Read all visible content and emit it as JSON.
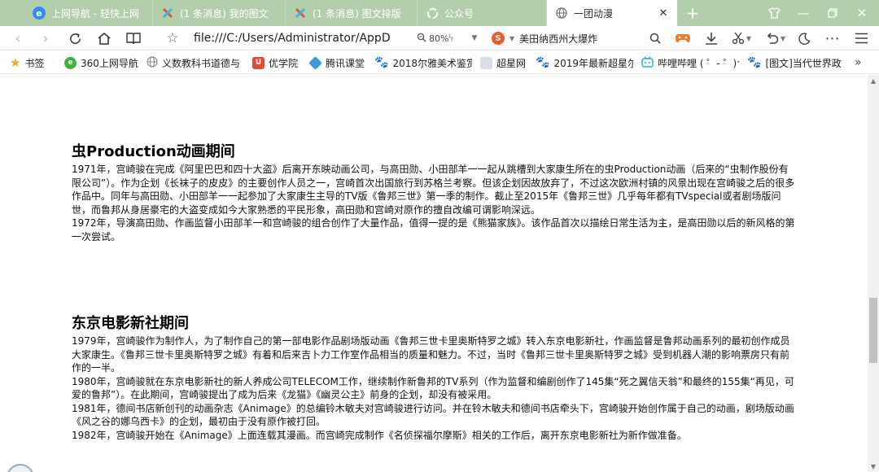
{
  "tabs": [
    {
      "title": "上网导航 - 轻快上网",
      "favicon": "e-browser-icon",
      "color": "#2d8ff0"
    },
    {
      "title": "(1 条消息) 我的图文",
      "favicon": "colorful-x-icon",
      "color": "#e0533a"
    },
    {
      "title": "(1 条消息) 图文排版",
      "favicon": "colorful-x-icon",
      "color": "#e0533a"
    },
    {
      "title": "公众号",
      "favicon": "wechat-spin-icon",
      "color": "#ffffff"
    },
    {
      "title": "一团动漫",
      "favicon": "globe-icon",
      "color": "#666666",
      "active": true
    }
  ],
  "address": {
    "url": "file:///C:/Users/Administrator/AppD",
    "zoom": "80%",
    "search_text": "美田纳西州大爆炸"
  },
  "bookmarks": [
    {
      "label": "书签",
      "icon": "star-icon",
      "color": "#f5a623"
    },
    {
      "label": "360上网导航",
      "icon": "360-icon",
      "color": "#3cb43c"
    },
    {
      "label": "义数教科书道德与",
      "icon": "globe-icon",
      "color": "#8a8a8a"
    },
    {
      "label": "优学院",
      "icon": "youxueyuan-icon",
      "color": "#e04a3a"
    },
    {
      "label": "腾讯课堂",
      "icon": "tencent-class-icon",
      "color": "#3a9be0"
    },
    {
      "label": "2018尔雅美术鉴赏",
      "icon": "paw-icon",
      "color": "#3060d0"
    },
    {
      "label": "超星网",
      "icon": "chaoxing-icon",
      "color": "#d8dde8"
    },
    {
      "label": "2019年最新超星尔",
      "icon": "paw-icon",
      "color": "#3060d0"
    },
    {
      "label": "哔哩哔哩 ( ゜- ゜)つ",
      "icon": "bilibili-icon",
      "color": "#23ade5"
    },
    {
      "label": "[图文]当代世界政",
      "icon": "paw-icon",
      "color": "#3060d0"
    }
  ],
  "sections": [
    {
      "heading": "虫Production动画期间",
      "paragraphs": [
        "1971年，宫崎骏在完成《阿里巴巴和四十大盗》后离开东映动画公司，与高田勋、小田部羊一一起从跳槽到大家康生所在的虫Production动画（后来的“虫制作股份有限公司”）。作为企划《长袜子的皮皮》的主要创作人员之一，宫崎首次出国旅行到苏格兰考察。但该企划因故放弃了，不过这次欧洲村镇的风景出现在宫崎骏之后的很多作品中。同年与高田勋、小田部羊一一起参加了大家康生主导的TV版《鲁邦三世》第一季的制作。截止至2015年《鲁邦三世》几乎每年都有TVspecial或者剧场版问世，而鲁邦从身居豪宅的大盗变成如今大家熟悉的平民形象，高田勋和宫崎对原作的擅自改编可谓影响深远。",
        "1972年，导演高田勋、作画监督小田部羊一和宫崎骏的组合创作了大量作品，值得一提的是《熊猫家族》。该作品首次以描绘日常生活为主，是高田勋以后的新风格的第一次尝试。"
      ]
    },
    {
      "heading": "东京电影新社期间",
      "paragraphs": [
        "1979年，宫崎骏作为制作人，为了制作自己的第一部电影作品剧场版动画《鲁邦三世卡里奥斯特罗之城》转入东京电影新社，作画监督是鲁邦动画系列的最初创作成员大家康生。《鲁邦三世卡里奥斯特罗之城》有着和后来吉卜力工作室作品相当的质量和魅力。不过，当时《鲁邦三世卡里奥斯特罗之城》受到机器人潮的影响票房只有前作的一半。",
        "1980年，宫崎骏就在东京电影新社的新人养成公司TELECOM工作，继续制作新鲁邦的TV系列（作为监督和编剧创作了145集“死之翼信天翁”和最终的155集“再见，可爱的鲁邦”）。在此期间，宫崎骏提出了成为后来《龙猫》《幽灵公主》前身的企划，却没有被采用。",
        "1981年，德间书店新创刊的动画杂志《Animage》的总编铃木敏夫对宫崎骏进行访问。并在铃木敏夫和德间书店牵头下，宫崎骏开始创作属于自己的动画，剧场版动画《风之谷的娜乌西卡》的企划，最初由于没有原作被打回。",
        "1982年，宫崎骏开始在《Animage》上面连载其漫画。而宫崎完成制作《名侦探福尔摩斯》相关的工作后，离开东京电影新社为新作做准备。"
      ]
    }
  ]
}
